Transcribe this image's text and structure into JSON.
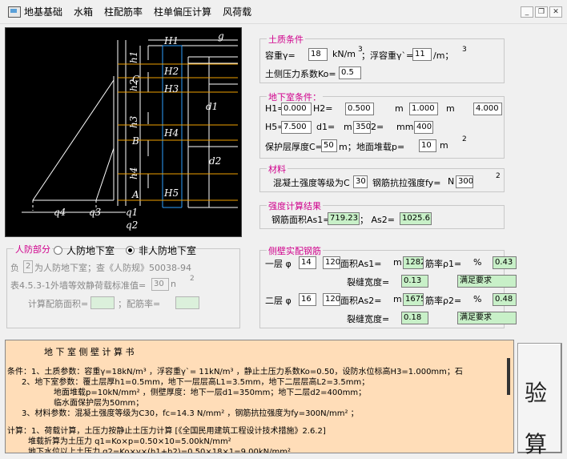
{
  "menu": {
    "items": [
      "地基基础",
      "水箱",
      "柱配筋率",
      "柱单偏压计算",
      "风荷载"
    ]
  },
  "diagram": {
    "labels": {
      "g": "g",
      "H1": "H1",
      "H2": "H2",
      "H3": "H3",
      "H4": "H4",
      "H5": "H5",
      "h1": "h1",
      "h2": "h2",
      "h3": "h3",
      "h4": "h4",
      "d1": "d1",
      "d2": "d2",
      "C": "C",
      "B": "B",
      "A": "A",
      "q4": "q4",
      "q3": "q3",
      "q1": "q1",
      "q2": "q2"
    }
  },
  "soil": {
    "title": "土质条件",
    "unit_weight_label": "容重γ=",
    "unit_weight": "18",
    "unit_weight_unit": "kN/m",
    "sup3a": "3",
    "buoyant_label": "；浮容重γ`=",
    "buoyant": "11",
    "buoyant_unit": "/m；",
    "sup3b": "3",
    "k0_label": "土侧压力系数Ko=",
    "k0": "0.5"
  },
  "basement": {
    "title": "地下室条件：",
    "h1_label": "H1=",
    "h1": "0.000",
    "h2_label": "H2=",
    "h2": "0.500",
    "m1": "m",
    "h3": "1.000",
    "m2": "m",
    "h4": "4.000",
    "h5_label": "H5=",
    "h5": "7.500",
    "d1_label": "d1=",
    "m3": "m",
    "d1": "350",
    "d2_label": "2=",
    "mm": "mm",
    "d2": "400",
    "cover_label": "保护层厚度C=",
    "cover": "50",
    "cover_unit": "m；",
    "surcharge_label": "地面堆载p=",
    "surcharge": "10",
    "surcharge_unit": "m",
    "sup2": "2"
  },
  "material": {
    "title": "材料",
    "concrete_label": "混凝土强度等级为C",
    "concrete": "30",
    "steel_label": "钢筋抗拉强度fy=",
    "n": "N",
    "steel": "300",
    "sup2": "2"
  },
  "strength": {
    "title": "强度计算结果",
    "as1_label": "钢筋面积As1=",
    "as1": "719.23",
    "as2_label": "；  As2=",
    "as2": "1025.6"
  },
  "reinf": {
    "title": "侧壁实配钢筋",
    "row1_label": "一层 φ",
    "row1_dia": "14",
    "row1_sp": "120",
    "row1_area_label": "面积As1=",
    "m_a": "m",
    "row1_area": "1282.",
    "row1_rho_label": "筋率ρ1=",
    "pct_a": "%",
    "row1_rho": "0.43",
    "crack1_label": "裂缝宽度=",
    "crack1": "0.13",
    "ok1": "满足要求",
    "row2_label": "二层 φ",
    "row2_dia": "16",
    "row2_sp": "120",
    "row2_area_label": "面积As2=",
    "m_b": "m",
    "row2_area": "1675.",
    "row2_rho_label": "筋率ρ2=",
    "pct_b": "%",
    "row2_rho": "0.48",
    "crack2_label": "裂缝宽度=",
    "crack2": "0.18",
    "ok2": "满足要求"
  },
  "civil": {
    "title": "人防部分",
    "opt1": "人防地下室",
    "opt2": "非人防地下室",
    "line1a": "负",
    "line1b": "2",
    "line1c": "为人防地下室；查《人防规》50038-94",
    "line2": "表4.5.3-1外墙等效静荷载标准值=",
    "line2v": "30",
    "line2u": "n",
    "sup2": "2",
    "area_label": "计算配筋面积=",
    "rho_label": "；配筋率="
  },
  "report": {
    "title": "地 下 室 侧 壁 计 算 书",
    "lines": [
      "条件：1、土质参数：容重γ=18kN/m³ ，浮容重γ`= 11kN/m³ ，静止土压力系数Ko=0.50，设防水位标高H3=1.000mm；⽯",
      "2、地下室参数：覆土层厚h1=0.5mm，地下一层层高L1=3.5mm，地下二层层高L2=3.5mm；",
      "地面堆载p=10kN/mm² ，侧壁厚度：地下一层d1=350mm；地下二层d2=400mm；",
      "临水面保护层为50mm；",
      "3、材料参数：混凝土强度等级为C30，fc=14.3 N/mm² ，钢筋抗拉强度为fy=300N/mm² ；",
      "计算：1、荷载计算，土压力按静止土压力计算 [《全国民用建筑工程设计技术措施》2.6.2]",
      "堆载折算为土压力   q1=Ko×p=0.50×10=5.00kN/mm²",
      "地下水位以上土压力 q2=Ko×γ×(h1+h2)=0.50×18×1=9.00kN/mm²"
    ]
  },
  "side_button": {
    "chars": [
      "验",
      "算"
    ]
  }
}
